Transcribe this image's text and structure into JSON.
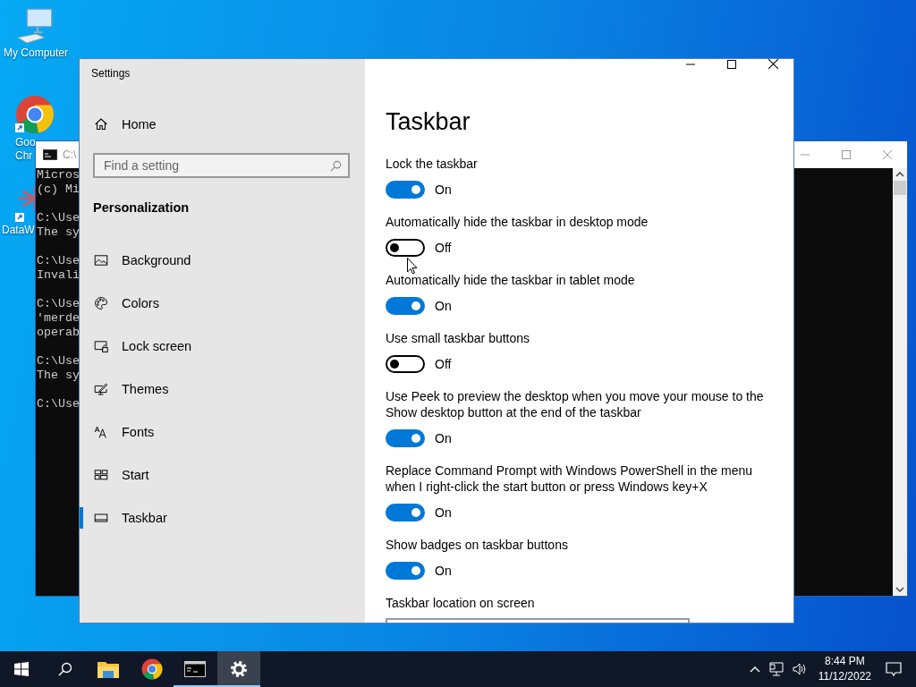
{
  "desktop": {
    "icons": [
      {
        "kind": "computer",
        "lines": [
          "My Computer"
        ]
      },
      {
        "kind": "chrome",
        "lines": [
          "Goo",
          "Chr"
        ]
      },
      {
        "kind": "data",
        "lines": [
          "DataW"
        ]
      }
    ]
  },
  "console_window": {
    "title": "C:\\",
    "blocks": [
      [
        "Micros",
        "(c) Mi"
      ],
      [
        "C:\\Use",
        "The sy"
      ],
      [
        "C:\\Use",
        "Invali"
      ],
      [
        "C:\\Use",
        "'merde",
        "operab"
      ],
      [
        "C:\\Use",
        "The sy"
      ],
      [
        "C:\\Use"
      ]
    ]
  },
  "settings_window": {
    "title": "Settings",
    "home": "Home",
    "search": {
      "placeholder": "Find a setting"
    },
    "section": "Personalization",
    "nav": [
      {
        "kind": "background",
        "label": "Background",
        "selected": false
      },
      {
        "kind": "colors",
        "label": "Colors",
        "selected": false
      },
      {
        "kind": "lockscreen",
        "label": "Lock screen",
        "selected": false
      },
      {
        "kind": "themes",
        "label": "Themes",
        "selected": false
      },
      {
        "kind": "fonts",
        "label": "Fonts",
        "selected": false
      },
      {
        "kind": "start",
        "label": "Start",
        "selected": false
      },
      {
        "kind": "taskbar",
        "label": "Taskbar",
        "selected": true
      }
    ],
    "page_title": "Taskbar",
    "settings": [
      {
        "kind": "toggle",
        "label": "Lock the taskbar",
        "on": true,
        "state": "On"
      },
      {
        "kind": "toggle",
        "label": "Automatically hide the taskbar in desktop mode",
        "on": false,
        "state": "Off"
      },
      {
        "kind": "toggle",
        "label": "Automatically hide the taskbar in tablet mode",
        "on": true,
        "state": "On"
      },
      {
        "kind": "toggle",
        "label": "Use small taskbar buttons",
        "on": false,
        "state": "Off"
      },
      {
        "kind": "toggle",
        "label": "Use Peek to preview the desktop when you move your mouse to the Show desktop button at the end of the taskbar",
        "on": true,
        "state": "On"
      },
      {
        "kind": "toggle",
        "label": "Replace Command Prompt with Windows PowerShell in the menu when I right-click the start button or press Windows key+X",
        "on": true,
        "state": "On"
      },
      {
        "kind": "toggle",
        "label": "Show badges on taskbar buttons",
        "on": true,
        "state": "On"
      },
      {
        "kind": "dropdown",
        "label": "Taskbar location on screen"
      }
    ]
  },
  "taskbar": {
    "apps": [
      {
        "kind": "explorer",
        "running": false,
        "selected": false
      },
      {
        "kind": "chrome",
        "running": false,
        "selected": false
      },
      {
        "kind": "cmd",
        "running": true,
        "selected": false
      },
      {
        "kind": "settings",
        "running": true,
        "selected": true
      }
    ],
    "time": "8:44 PM",
    "date": "11/12/2022"
  }
}
